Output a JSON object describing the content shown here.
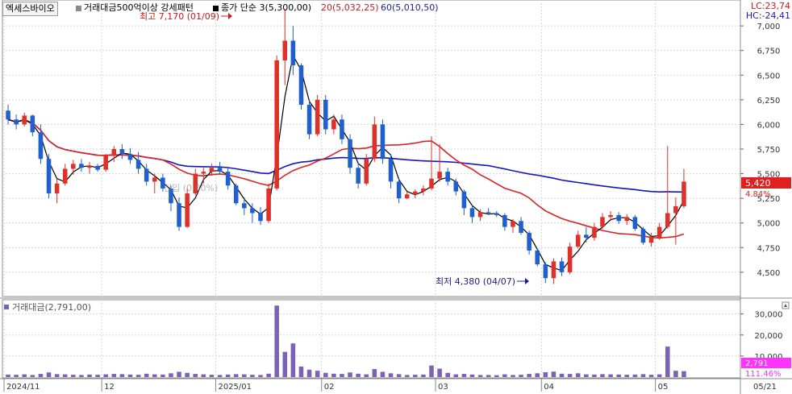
{
  "header": {
    "symbol": "엑세스바이오",
    "indicator": "거래대금500억이상 강세패턴",
    "ma_group_label": "종가 단순 3(5,300,00)",
    "ma20_label": "20(5,032,25)",
    "ma60_label": "60(5,010,50)",
    "lc_label": "LC:23,74",
    "hc_label": "HC:-24,41"
  },
  "colors": {
    "up": "#e0302a",
    "down": "#1f5fcf",
    "ma3": "#000000",
    "ma20": "#e02020",
    "ma60": "#1414c8",
    "volume": "#7c62b4",
    "price_box": "#e02020",
    "volume_box": "#ff33ff"
  },
  "annotations": {
    "high": "최고 7,170 (01/09)",
    "low": "최저 4,380 (04/07)",
    "ghost": "진입 (0.00%)"
  },
  "current": {
    "price": "5,420",
    "change": "4.84%",
    "volume": "2,791",
    "volume_change": "111.46%"
  },
  "volume_panel": {
    "label": "거래대금(2,791,00)"
  },
  "chart_data": {
    "type": "candlestick",
    "price_axis": {
      "ticks": [
        "7,000",
        "6,750",
        "6,500",
        "6,250",
        "6,000",
        "5,750",
        "5,500",
        "5,250",
        "5,000",
        "4,750",
        "4,500"
      ],
      "range": [
        4270,
        7230
      ]
    },
    "volume_axis": {
      "ticks": [
        "30,000",
        "20,000",
        "10,000"
      ],
      "range": [
        0,
        36000
      ]
    },
    "x_labels": [
      "2024/11",
      "12",
      "2025/01",
      "02",
      "03",
      "04",
      "05",
      "05/21"
    ],
    "candles": [
      [
        6140,
        6200,
        6000,
        6050
      ],
      [
        6050,
        6100,
        5950,
        6000
      ],
      [
        6000,
        6120,
        5980,
        6090
      ],
      [
        6090,
        6100,
        5880,
        5920
      ],
      [
        5920,
        6000,
        5600,
        5650
      ],
      [
        5650,
        5700,
        5250,
        5300
      ],
      [
        5300,
        5450,
        5200,
        5400
      ],
      [
        5400,
        5600,
        5380,
        5550
      ],
      [
        5550,
        5640,
        5490,
        5600
      ],
      [
        5600,
        5650,
        5520,
        5560
      ],
      [
        5560,
        5620,
        5500,
        5580
      ],
      [
        5580,
        5600,
        5520,
        5540
      ],
      [
        5540,
        5700,
        5520,
        5680
      ],
      [
        5680,
        5780,
        5620,
        5750
      ],
      [
        5750,
        5800,
        5650,
        5700
      ],
      [
        5700,
        5760,
        5600,
        5640
      ],
      [
        5640,
        5720,
        5500,
        5550
      ],
      [
        5550,
        5600,
        5380,
        5420
      ],
      [
        5420,
        5500,
        5300,
        5460
      ],
      [
        5460,
        5500,
        5320,
        5350
      ],
      [
        5350,
        5380,
        5120,
        5200
      ],
      [
        5200,
        5260,
        4920,
        4960
      ],
      [
        4960,
        5350,
        4950,
        5300
      ],
      [
        5300,
        5550,
        5280,
        5500
      ],
      [
        5500,
        5560,
        5400,
        5520
      ],
      [
        5520,
        5600,
        5480,
        5560
      ],
      [
        5560,
        5620,
        5500,
        5520
      ],
      [
        5520,
        5560,
        5340,
        5380
      ],
      [
        5380,
        5400,
        5180,
        5200
      ],
      [
        5200,
        5260,
        5080,
        5150
      ],
      [
        5150,
        5200,
        5000,
        5100
      ],
      [
        5100,
        5160,
        4980,
        5020
      ],
      [
        5020,
        5400,
        5000,
        5350
      ],
      [
        5350,
        6700,
        5330,
        6650
      ],
      [
        6650,
        7170,
        6400,
        6850
      ],
      [
        6850,
        7000,
        6500,
        6600
      ],
      [
        6600,
        6620,
        6150,
        6200
      ],
      [
        6200,
        6250,
        5850,
        5900
      ],
      [
        5900,
        6300,
        5880,
        6250
      ],
      [
        6250,
        6300,
        5900,
        5950
      ],
      [
        5950,
        6100,
        5900,
        6050
      ],
      [
        6050,
        6100,
        5800,
        5850
      ],
      [
        5850,
        5900,
        5500,
        5560
      ],
      [
        5560,
        5620,
        5350,
        5400
      ],
      [
        5400,
        5700,
        5380,
        5650
      ],
      [
        5650,
        6080,
        5620,
        6000
      ],
      [
        6000,
        6050,
        5600,
        5650
      ],
      [
        5650,
        5700,
        5350,
        5420
      ],
      [
        5420,
        5460,
        5200,
        5250
      ],
      [
        5250,
        5320,
        5240,
        5290
      ],
      [
        5290,
        5340,
        5250,
        5320
      ],
      [
        5320,
        5380,
        5280,
        5350
      ],
      [
        5350,
        5880,
        5330,
        5450
      ],
      [
        5450,
        5800,
        5420,
        5520
      ],
      [
        5520,
        5560,
        5380,
        5420
      ],
      [
        5420,
        5450,
        5280,
        5320
      ],
      [
        5320,
        5340,
        5080,
        5150
      ],
      [
        5150,
        5180,
        5000,
        5060
      ],
      [
        5060,
        5140,
        5020,
        5110
      ],
      [
        5110,
        5150,
        5080,
        5100
      ],
      [
        5100,
        5120,
        5060,
        5080
      ],
      [
        5080,
        5100,
        4920,
        4960
      ],
      [
        4960,
        5040,
        4900,
        5020
      ],
      [
        5020,
        5060,
        4880,
        4900
      ],
      [
        4900,
        4920,
        4680,
        4720
      ],
      [
        4720,
        4740,
        4560,
        4580
      ],
      [
        4580,
        4600,
        4390,
        4440
      ],
      [
        4440,
        4640,
        4380,
        4610
      ],
      [
        4610,
        4650,
        4460,
        4500
      ],
      [
        4500,
        4800,
        4480,
        4760
      ],
      [
        4760,
        4920,
        4740,
        4880
      ],
      [
        4880,
        4960,
        4800,
        4850
      ],
      [
        4850,
        5000,
        4820,
        4960
      ],
      [
        4960,
        5100,
        4940,
        5060
      ],
      [
        5060,
        5120,
        5020,
        5080
      ],
      [
        5080,
        5110,
        4990,
        5020
      ],
      [
        5020,
        5090,
        4980,
        5060
      ],
      [
        5060,
        5080,
        4920,
        4940
      ],
      [
        4940,
        4960,
        4780,
        4800
      ],
      [
        4800,
        4900,
        4760,
        4850
      ],
      [
        4850,
        5000,
        4830,
        4960
      ],
      [
        4960,
        5780,
        4940,
        5100
      ],
      [
        5100,
        5260,
        4780,
        5170
      ],
      [
        5170,
        5550,
        5150,
        5420
      ]
    ],
    "volumes": [
      1200,
      1100,
      1300,
      1000,
      1500,
      2200,
      1400,
      1300,
      1100,
      1000,
      1200,
      1100,
      1300,
      1500,
      1400,
      1200,
      1100,
      1600,
      1300,
      1200,
      1800,
      2500,
      2000,
      1500,
      1300,
      1100,
      1000,
      1200,
      1400,
      1300,
      1100,
      1000,
      1600,
      34000,
      12000,
      16000,
      5000,
      3500,
      3000,
      2000,
      1600,
      1500,
      2200,
      1600,
      1300,
      3800,
      2500,
      1800,
      1400,
      1000,
      1100,
      1200,
      5500,
      4000,
      2000,
      1300,
      1500,
      1200,
      1000,
      1000,
      900,
      1300,
      1000,
      1100,
      1500,
      1800,
      2300,
      2600,
      1600,
      1500,
      1800,
      1300,
      1200,
      1400,
      1300,
      1200,
      1100,
      1200,
      1400,
      1100,
      1300,
      14500,
      3000,
      2800
    ]
  }
}
